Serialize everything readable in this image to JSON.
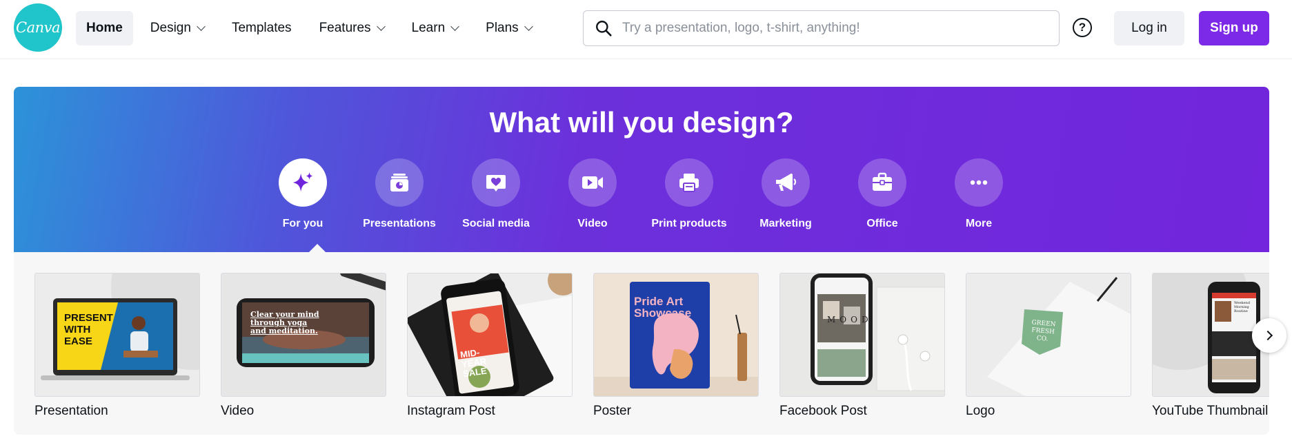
{
  "brand": {
    "logo_text": "Canva",
    "accent": "#7d2ae8",
    "logo_color": "#20c4cb"
  },
  "nav": {
    "items": [
      {
        "label": "Home",
        "active": true,
        "dropdown": false
      },
      {
        "label": "Design",
        "active": false,
        "dropdown": true
      },
      {
        "label": "Templates",
        "active": false,
        "dropdown": false
      },
      {
        "label": "Features",
        "active": false,
        "dropdown": true
      },
      {
        "label": "Learn",
        "active": false,
        "dropdown": true
      },
      {
        "label": "Plans",
        "active": false,
        "dropdown": true
      }
    ]
  },
  "search": {
    "placeholder": "Try a presentation, logo, t-shirt, anything!",
    "value": "",
    "icon": "search-icon"
  },
  "header": {
    "help_icon": "help-icon",
    "login_label": "Log in",
    "signup_label": "Sign up"
  },
  "hero": {
    "title": "What will you design?",
    "categories": [
      {
        "label": "For you",
        "icon": "sparkle-icon",
        "active": true
      },
      {
        "label": "Presentations",
        "icon": "presentation-icon",
        "active": false
      },
      {
        "label": "Social media",
        "icon": "heart-chat-icon",
        "active": false
      },
      {
        "label": "Video",
        "icon": "video-camera-icon",
        "active": false
      },
      {
        "label": "Print products",
        "icon": "printer-icon",
        "active": false
      },
      {
        "label": "Marketing",
        "icon": "megaphone-icon",
        "active": false
      },
      {
        "label": "Office",
        "icon": "briefcase-icon",
        "active": false
      },
      {
        "label": "More",
        "icon": "more-dots-icon",
        "active": false
      }
    ]
  },
  "designs": {
    "cards": [
      {
        "title": "Presentation",
        "thumb_text": "PRESENT WITH EASE"
      },
      {
        "title": "Video",
        "thumb_text": "Clear your mind through yoga and meditation."
      },
      {
        "title": "Instagram Post",
        "thumb_text": "MID-YEAR SALE"
      },
      {
        "title": "Poster",
        "thumb_text": "Pride Art Showcase"
      },
      {
        "title": "Facebook Post",
        "thumb_text": "MOOD"
      },
      {
        "title": "Logo",
        "thumb_text": "GREEN FRESH CO."
      },
      {
        "title": "YouTube Thumbnail",
        "thumb_text": "Weekend Morning Routine"
      }
    ],
    "next_icon": "chevron-right-icon"
  }
}
